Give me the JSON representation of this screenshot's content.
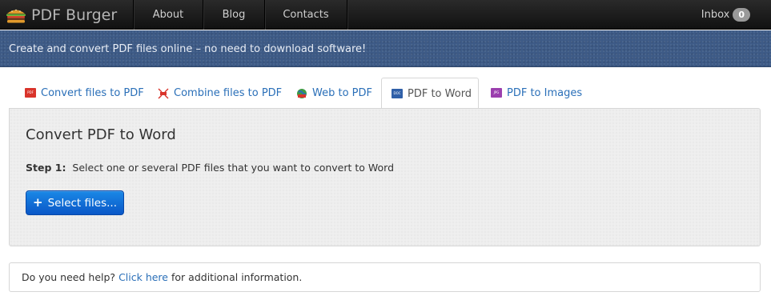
{
  "navbar": {
    "brand": "PDF Burger",
    "links": [
      {
        "label": "About"
      },
      {
        "label": "Blog"
      },
      {
        "label": "Contacts"
      }
    ],
    "inbox_label": "Inbox",
    "inbox_count": "0"
  },
  "banner": {
    "text": "Create and convert PDF files online – no need to download software!"
  },
  "tabs": [
    {
      "label": "Convert files to PDF",
      "icon": "pdf-file-icon",
      "color": "#d9342b"
    },
    {
      "label": "Combine files to PDF",
      "icon": "combine-icon",
      "color": "#d9342b"
    },
    {
      "label": "Web to PDF",
      "icon": "web-icon",
      "color": "#2f9a3a"
    },
    {
      "label": "PDF to Word",
      "icon": "doc-file-icon",
      "color": "#2f5fa8",
      "active": true
    },
    {
      "label": "PDF to Images",
      "icon": "jpg-file-icon",
      "color": "#9b3fae"
    }
  ],
  "panel": {
    "title": "Convert PDF to Word",
    "step_label": "Step 1:",
    "step_text": "Select one or several PDF files that you want to convert to Word",
    "select_button": "Select files..."
  },
  "help": {
    "prefix": "Do you need help?",
    "link": "Click here",
    "suffix": "for additional information."
  }
}
